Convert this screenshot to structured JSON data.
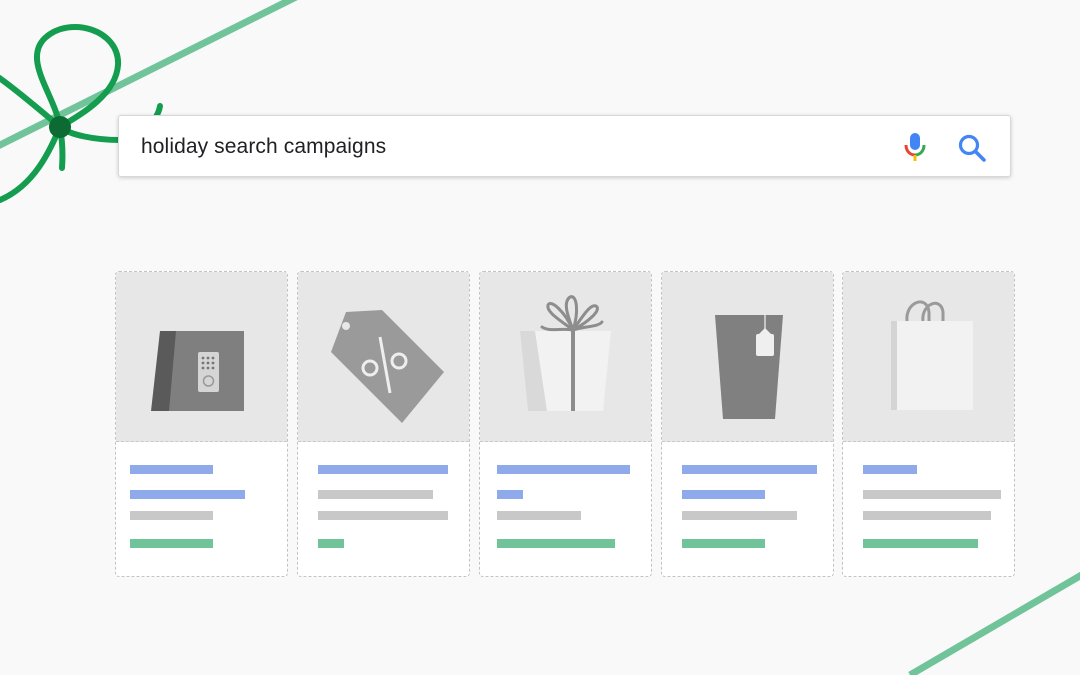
{
  "search": {
    "query": "holiday search campaigns",
    "mic_icon": "microphone-icon",
    "search_icon": "magnifier-icon"
  },
  "colors": {
    "background": "#f9f9f9",
    "ribbon": "#71c49a",
    "bow": "#149d4f",
    "bow_knot": "#0b6b33",
    "placeholder_blue": "#8eaaea",
    "placeholder_grey": "#c8c8c8",
    "placeholder_green": "#71c49a",
    "image_bg": "#e7e7e7"
  },
  "results": [
    {
      "image": "smart-lock-icon"
    },
    {
      "image": "discount-tag-icon"
    },
    {
      "image": "gift-box-icon"
    },
    {
      "image": "cup-icon"
    },
    {
      "image": "shopping-bag-icon"
    }
  ]
}
